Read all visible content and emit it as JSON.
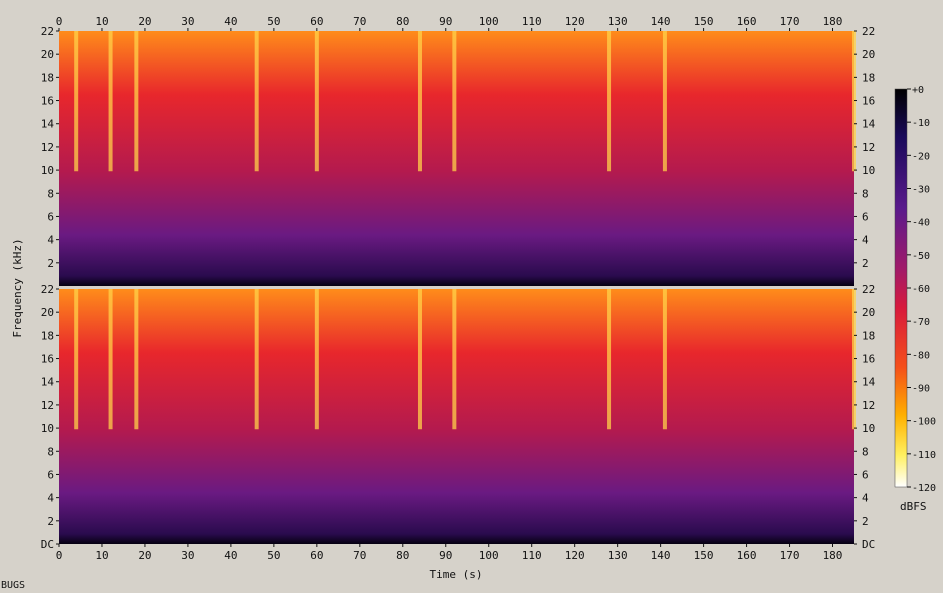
{
  "chart_data": {
    "type": "heatmap",
    "title": "",
    "xlabel": "Time (s)",
    "ylabel": "Frequency (kHz)",
    "x_range": [
      0,
      185
    ],
    "x_ticks": [
      "0",
      "10",
      "20",
      "30",
      "40",
      "50",
      "60",
      "70",
      "80",
      "90",
      "100",
      "110",
      "120",
      "130",
      "140",
      "150",
      "160",
      "170",
      "180"
    ],
    "y_range_khz": [
      0,
      22
    ],
    "y_ticks": [
      "DC",
      "2",
      "4",
      "6",
      "8",
      "10",
      "12",
      "14",
      "16",
      "18",
      "20",
      "22"
    ],
    "channels": [
      "upper",
      "lower"
    ],
    "colorbar": {
      "label": "dBFS",
      "range": [
        -120,
        0
      ],
      "ticks": [
        "+0",
        "-10",
        "-20",
        "-30",
        "-40",
        "-50",
        "-60",
        "-70",
        "-80",
        "-90",
        "-100",
        "-110",
        "-120"
      ]
    },
    "bright_bands_s": [
      4,
      12,
      18,
      46,
      60,
      84,
      92,
      128,
      141,
      185
    ],
    "footer": "BUGS"
  },
  "colors": {
    "background": "#d6d2ca",
    "scale_hot": "#fffde0",
    "scale_mid": "#e21a3c",
    "scale_low": "#4a1a8a",
    "scale_floor": "#000000"
  }
}
